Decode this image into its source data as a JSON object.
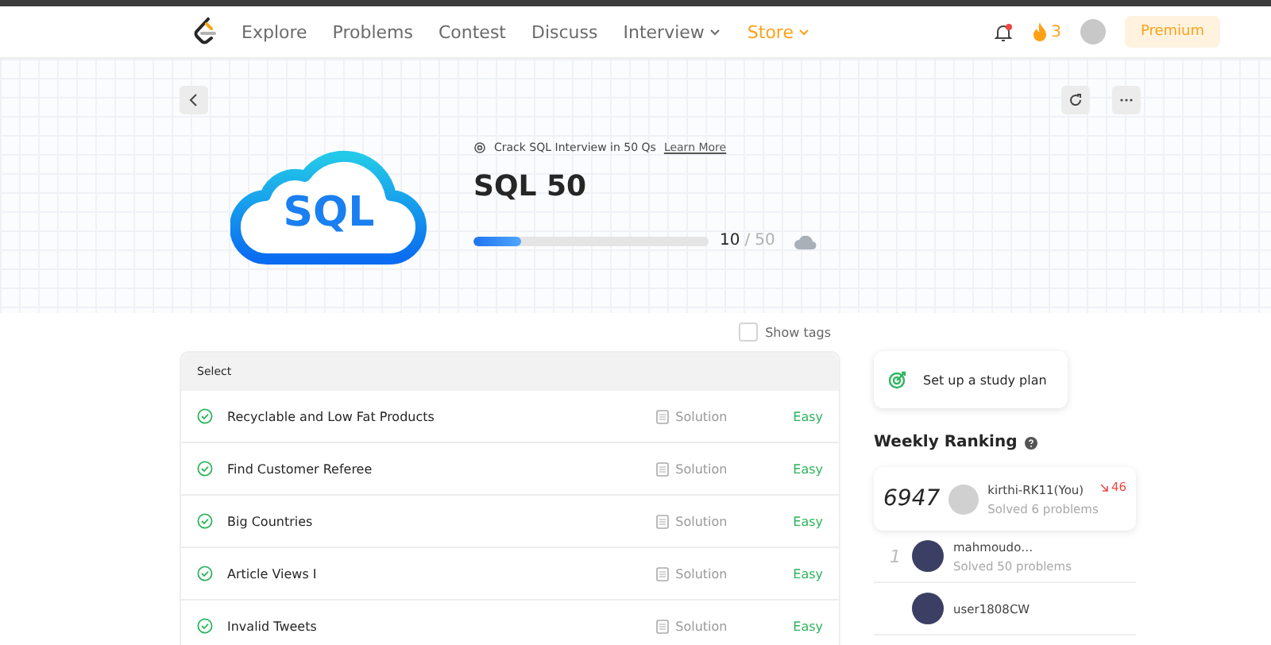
{
  "nav": {
    "links": [
      {
        "label": "Explore",
        "kind": "link"
      },
      {
        "label": "Problems",
        "kind": "link"
      },
      {
        "label": "Contest",
        "kind": "link"
      },
      {
        "label": "Discuss",
        "kind": "link"
      },
      {
        "label": "Interview",
        "kind": "menu"
      },
      {
        "label": "Store",
        "kind": "store"
      }
    ],
    "streak": "3",
    "premium": "Premium"
  },
  "hero": {
    "promo": "Crack SQL Interview in 50 Qs",
    "promo_link": "Learn More",
    "title": "SQL 50",
    "logo_text": "SQL",
    "progress": {
      "level": 0.2,
      "solved": "10",
      "separator": "/",
      "total": "50"
    }
  },
  "show_tags": {
    "label": "Show tags",
    "checked": false
  },
  "table": {
    "header": "Select",
    "rows": [
      {
        "title": "Recyclable and Low Fat Products",
        "solved": true,
        "solution": "Solution",
        "difficulty": "Easy",
        "kind": "easy"
      },
      {
        "title": "Find Customer Referee",
        "solved": true,
        "solution": "Solution",
        "difficulty": "Easy",
        "kind": "easy"
      },
      {
        "title": "Big Countries",
        "solved": true,
        "solution": "Solution",
        "difficulty": "Easy",
        "kind": "easy"
      },
      {
        "title": "Article Views I",
        "solved": true,
        "solution": "Solution",
        "difficulty": "Easy",
        "kind": "easy"
      },
      {
        "title": "Invalid Tweets",
        "solved": true,
        "solution": "Solution",
        "difficulty": "Easy",
        "kind": "easy"
      }
    ]
  },
  "sidebar": {
    "study_plan": "Set up a study plan",
    "ranking_title": "Weekly Ranking",
    "me": {
      "rank": "6947",
      "name": "kirthi-RK11(You)",
      "solved": "Solved 6 problems",
      "change": "46",
      "falling": true
    },
    "leaders": [
      {
        "rank": "1",
        "name": "mahmoudo…",
        "solved": "Solved 50 problems"
      },
      {
        "name": "user1808CW"
      }
    ]
  }
}
